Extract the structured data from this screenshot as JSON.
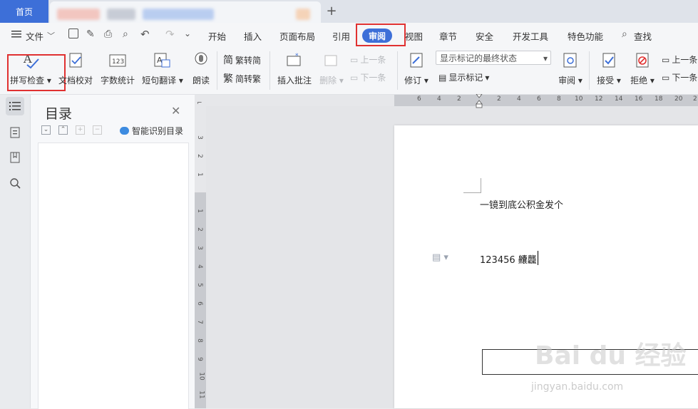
{
  "tabs": {
    "home": "首页"
  },
  "menu": {
    "file": "文件",
    "items": [
      "开始",
      "插入",
      "页面布局",
      "引用",
      "审阅",
      "视图",
      "章节",
      "安全",
      "开发工具",
      "特色功能"
    ],
    "find": "查找"
  },
  "ribbon": {
    "spell_check": "拼写检查",
    "doc_proof": "文档校对",
    "word_count": "字数统计",
    "translate": "短句翻译",
    "read_aloud": "朗读",
    "trad_to_simp": "繁转简",
    "simp_to_trad": "简转繁",
    "insert_comment": "插入批注",
    "delete": "删除",
    "prev": "上一条",
    "next": "下一条",
    "status_select": "显示标记的最终状态",
    "track_changes": "修订",
    "show_markup": "显示标记",
    "review": "审阅",
    "accept": "接受",
    "reject": "拒绝",
    "prev_right": "上一条",
    "next_right": "下一条"
  },
  "toc": {
    "title": "目录",
    "smart": "智能识别目录"
  },
  "rulers": {
    "h": [
      "6",
      "4",
      "2",
      "2",
      "4",
      "6",
      "8",
      "10",
      "12",
      "14",
      "16",
      "18",
      "20",
      "2"
    ],
    "v_top": [
      "3",
      "2",
      "1"
    ],
    "v_bottom": [
      "1",
      "2",
      "3",
      "4",
      "5",
      "6",
      "7",
      "8",
      "9",
      "10",
      "11"
    ]
  },
  "document": {
    "line1": "一镜到底公积金发个",
    "line2": "123456 齉龘"
  },
  "watermark": {
    "brand": "Bai du 经验",
    "url": "jingyan.baidu.com"
  },
  "colors": {
    "accent": "#3d6fd8",
    "highlight": "#e03131"
  }
}
